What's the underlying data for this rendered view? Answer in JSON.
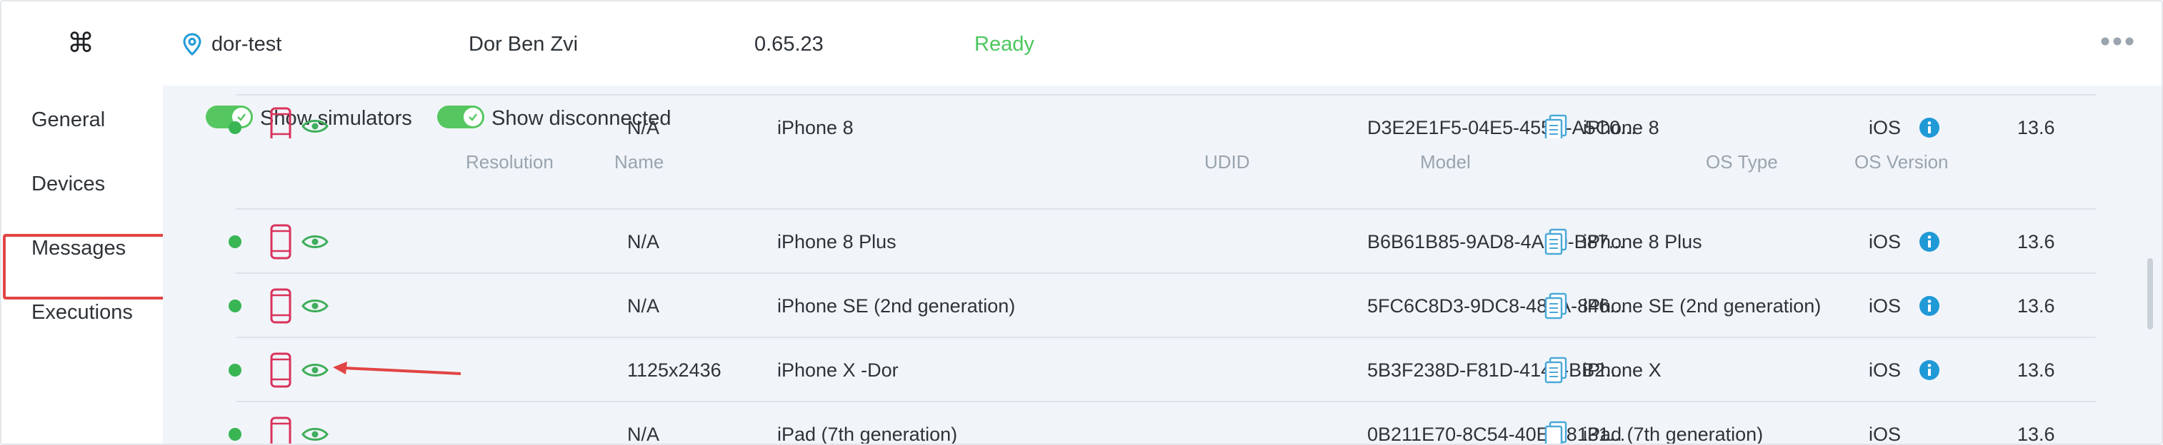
{
  "header": {
    "logo_glyph": "⌘",
    "location_icon": "location-pin-icon",
    "machine": "dor-test",
    "user": "Dor Ben Zvi",
    "version": "0.65.23",
    "status": "Ready",
    "status_color": "#4cc75e",
    "more_icon": "more-dots-icon"
  },
  "sidebar": {
    "items": [
      {
        "label": "General"
      },
      {
        "label": "Devices"
      },
      {
        "label": "Messages"
      },
      {
        "label": "Executions"
      }
    ],
    "selected": "Devices"
  },
  "toggles": {
    "simulators": {
      "label": "Show simulators",
      "on": true
    },
    "disconnected": {
      "label": "Show disconnected",
      "on": true
    }
  },
  "table": {
    "columns": [
      "Resolution",
      "Name",
      "UDID",
      "Model",
      "OS Type",
      "OS Version"
    ],
    "rows": [
      {
        "status": "online",
        "resolution": "N/A",
        "name": "iPhone 8",
        "udid": "D3E2E1F5-04E5-455D-A5C0...",
        "model": "iPhone 8",
        "os_type": "iOS",
        "os_version": "13.6"
      },
      {
        "status": "online",
        "resolution": "N/A",
        "name": "iPhone 8 Plus",
        "udid": "B6B61B85-9AD8-4AB0-B87...",
        "model": "iPhone 8 Plus",
        "os_type": "iOS",
        "os_version": "13.6"
      },
      {
        "status": "online",
        "resolution": "N/A",
        "name": "iPhone SE (2nd generation)",
        "udid": "5FC6C8D3-9DC8-481A-846...",
        "model": "iPhone SE (2nd generation)",
        "os_type": "iOS",
        "os_version": "13.6"
      },
      {
        "status": "online",
        "resolution": "1125x2436",
        "name": "iPhone X -Dor",
        "udid": "5B3F238D-F81D-4142-BB2...",
        "model": "iPhone X",
        "os_type": "iOS",
        "os_version": "13.6"
      },
      {
        "status": "online",
        "resolution": "N/A",
        "name": "iPad (7th generation)",
        "udid": "0B211E70-8C54-40E5-8131...",
        "model": "iPad (7th generation)",
        "os_type": "iOS",
        "os_version": "13.6"
      }
    ]
  },
  "colors": {
    "accent_green": "#39b554",
    "device_red": "#d9325a",
    "eye_green": "#3fae5a",
    "info_blue": "#1f9ad6",
    "highlight_red": "#e24444"
  }
}
